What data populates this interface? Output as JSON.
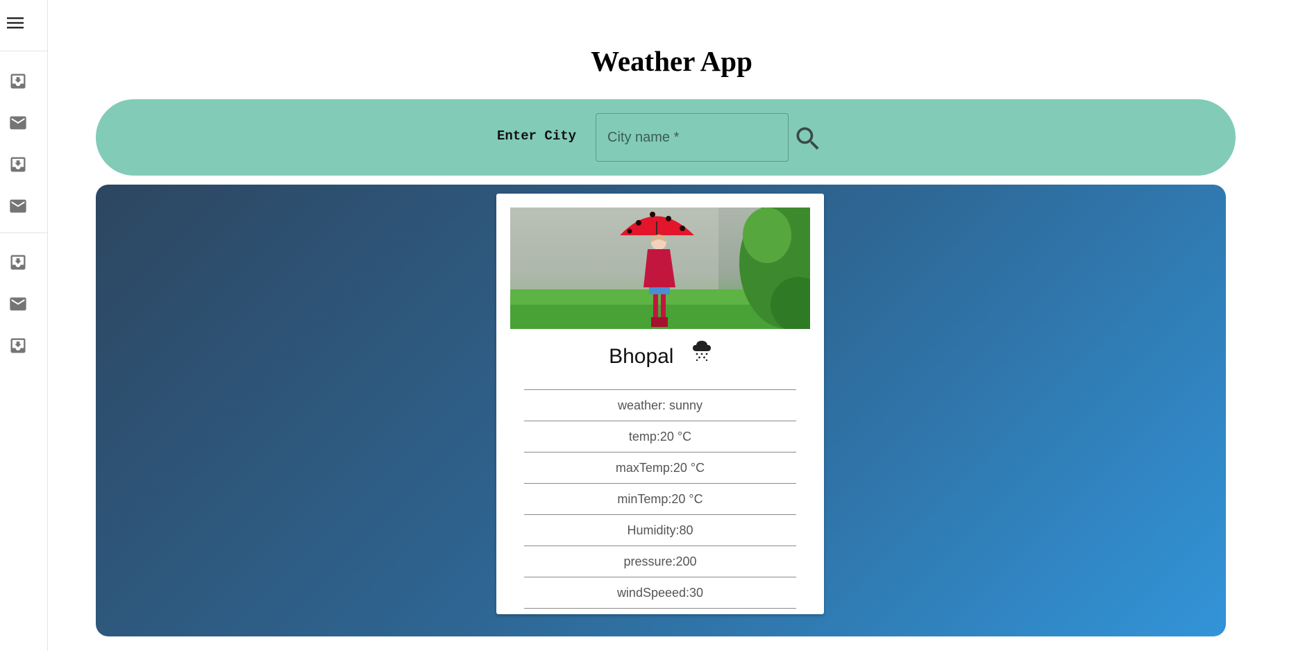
{
  "app": {
    "title": "Weather App"
  },
  "sidebar": {
    "menu_icon": "hamburger-menu-icon",
    "items": [
      {
        "icon": "inbox-download-icon"
      },
      {
        "icon": "mail-icon"
      },
      {
        "icon": "inbox-download-icon"
      },
      {
        "icon": "mail-icon"
      },
      {
        "icon": "inbox-download-icon"
      },
      {
        "icon": "mail-icon"
      },
      {
        "icon": "inbox-download-icon"
      }
    ]
  },
  "search": {
    "label": "Enter City",
    "placeholder": "City name *",
    "value": "",
    "button_icon": "search-icon"
  },
  "card": {
    "city": "Bhopal",
    "condition_icon": "snow-cloud-icon",
    "stats": [
      "weather: sunny",
      "temp:20 °C",
      "maxTemp:20 °C",
      "minTemp:20 °C",
      "Humidity:80",
      "pressure:200",
      "windSpeeed:30"
    ]
  },
  "colors": {
    "search_bar": "#82cbb7",
    "panel_gradient_start": "#2d4660",
    "panel_gradient_end": "#3294d8",
    "icon_gray": "#757575"
  }
}
